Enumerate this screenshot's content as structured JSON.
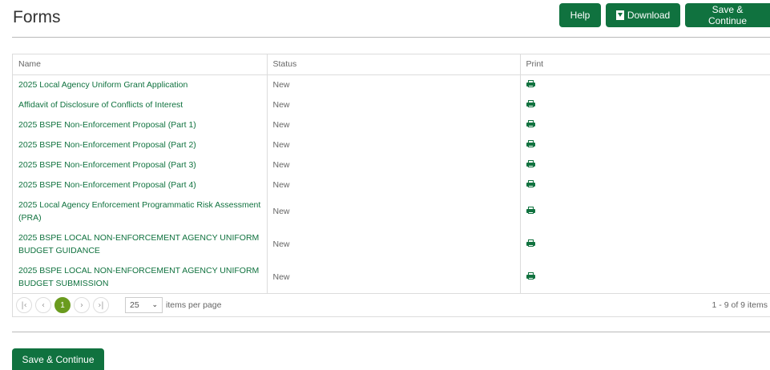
{
  "page": {
    "title": "Forms"
  },
  "toolbar": {
    "help_label": "Help",
    "download_label": "Download",
    "save_continue_label": "Save & Continue"
  },
  "table": {
    "columns": [
      "Name",
      "Status",
      "Print"
    ],
    "rows": [
      {
        "name": "2025 Local Agency Uniform Grant Application",
        "status": "New"
      },
      {
        "name": "Affidavit of Disclosure of Conflicts of Interest",
        "status": "New"
      },
      {
        "name": "2025 BSPE Non-Enforcement Proposal (Part 1)",
        "status": "New"
      },
      {
        "name": "2025 BSPE Non-Enforcement Proposal (Part 2)",
        "status": "New"
      },
      {
        "name": "2025 BSPE Non-Enforcement Proposal (Part 3)",
        "status": "New"
      },
      {
        "name": "2025 BSPE Non-Enforcement Proposal (Part 4)",
        "status": "New"
      },
      {
        "name": "2025 Local Agency Enforcement Programmatic Risk Assessment (PRA)",
        "status": "New"
      },
      {
        "name": "2025 BSPE LOCAL NON-ENFORCEMENT AGENCY UNIFORM BUDGET GUIDANCE",
        "status": "New"
      },
      {
        "name": "2025 BSPE LOCAL NON-ENFORCEMENT AGENCY UNIFORM BUDGET SUBMISSION",
        "status": "New"
      }
    ]
  },
  "pager": {
    "current_page": "1",
    "page_size": "25",
    "per_page_label": "items per page",
    "info": "1 - 9 of 9 items"
  },
  "footer": {
    "save_continue_label": "Save & Continue"
  },
  "icons": {
    "first": "first-page-icon",
    "prev": "prev-page-icon",
    "next": "next-page-icon",
    "last": "last-page-icon",
    "print": "print-icon",
    "download": "download-file-icon",
    "dropdown": "chevron-down-icon"
  },
  "colors": {
    "primary": "#10723f",
    "pager_active": "#6a9b1e"
  }
}
